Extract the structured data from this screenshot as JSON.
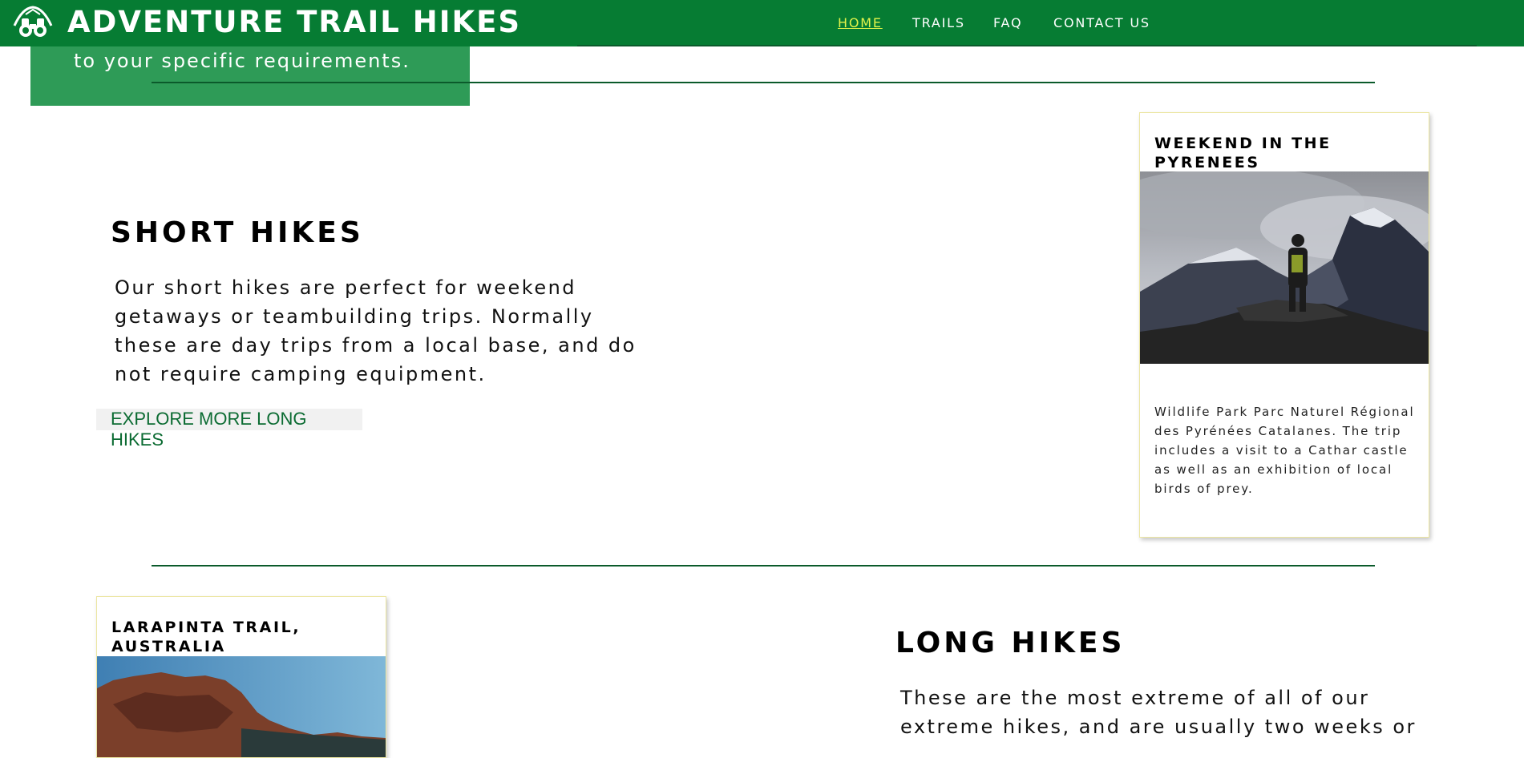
{
  "header": {
    "brand": "ADVENTURE TRAIL HIKES",
    "logo_icon": "binoculars-mountain-icon",
    "nav": [
      {
        "label": "HOME",
        "active": true
      },
      {
        "label": "TRAILS",
        "active": false
      },
      {
        "label": "FAQ",
        "active": false
      },
      {
        "label": "CONTACT US",
        "active": false
      }
    ]
  },
  "hero": {
    "text": "to your specific requirements."
  },
  "short_hikes": {
    "title": "SHORT HIKES",
    "body": "Our short hikes are perfect for weekend getaways or teambuilding trips. Normally these are day trips from a local base, and do not require camping equipment.",
    "button": "EXPLORE MORE LONG HIKES",
    "card": {
      "title": "WEEKEND IN THE PYRENEES",
      "image_desc": "hiker-on-mountain-photo",
      "body": "Wildlife Park Parc Naturel Régional des Pyrénées Catalanes. The trip includes a visit to a Cathar castle as well as an exhibition of local birds of prey."
    }
  },
  "long_hikes": {
    "title": "LONG HIKES",
    "body": "These are the most extreme of all of our extreme hikes, and are usually two weeks or",
    "card": {
      "title": "LARAPINTA TRAIL, AUSTRALIA",
      "image_desc": "red-rock-cliffs-photo"
    }
  },
  "colors": {
    "header_green": "#067c33",
    "hero_green": "#2e9b57",
    "rule_green": "#0b5a2b",
    "active_nav": "#e2f34a",
    "button_text": "#0b6b32"
  }
}
